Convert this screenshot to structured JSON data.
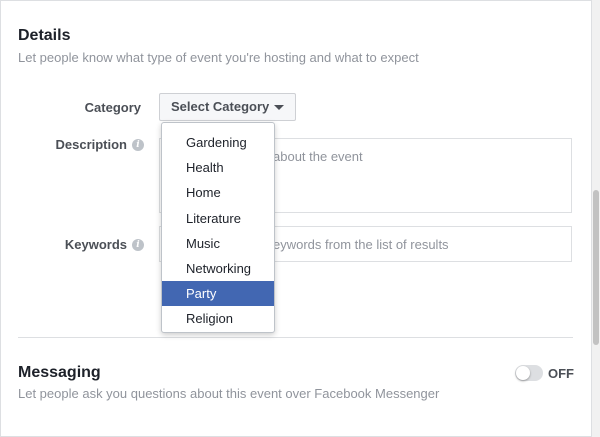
{
  "details": {
    "title": "Details",
    "subtitle": "Let people know what type of event you're hosting and what to expect"
  },
  "category": {
    "label": "Category",
    "select_label": "Select Category",
    "options": [
      "Gardening",
      "Health",
      "Home",
      "Literature",
      "Music",
      "Networking",
      "Party",
      "Religion"
    ],
    "highlighted_option": "Party"
  },
  "description": {
    "label": "Description",
    "placeholder_visible": "about the event",
    "icon": "info-icon"
  },
  "keywords": {
    "label": "Keywords",
    "placeholder_visible": "eywords from the list of results",
    "icon": "info-icon"
  },
  "messaging": {
    "title": "Messaging",
    "subtitle": "Let people ask you questions about this event over Facebook Messenger",
    "toggle_state": "OFF"
  },
  "colors": {
    "accent": "#4267b2",
    "text_primary": "#1d2129",
    "text_secondary": "#90949c",
    "border": "#dddfe2"
  }
}
